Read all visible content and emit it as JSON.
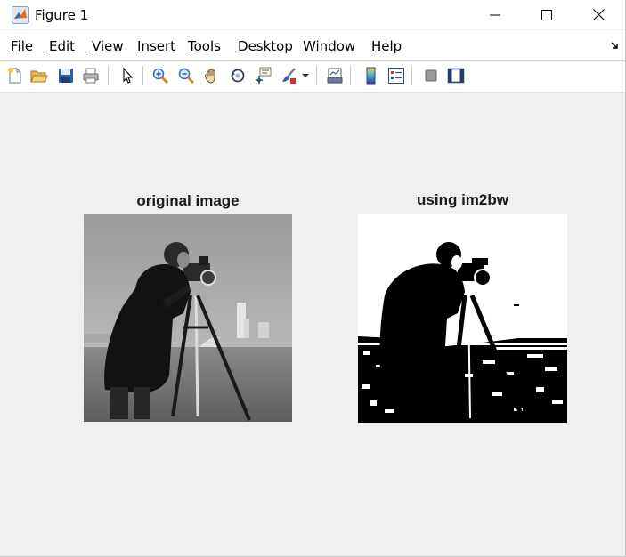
{
  "window": {
    "title": "Figure 1"
  },
  "menu": {
    "items": [
      {
        "mnemonic": "F",
        "rest": "ile"
      },
      {
        "mnemonic": "E",
        "rest": "dit"
      },
      {
        "mnemonic": "V",
        "rest": "iew"
      },
      {
        "mnemonic": "I",
        "rest": "nsert"
      },
      {
        "mnemonic": "T",
        "rest": "ools"
      },
      {
        "mnemonic": "D",
        "rest": "esktop"
      },
      {
        "mnemonic": "W",
        "rest": "indow"
      },
      {
        "mnemonic": "H",
        "rest": "elp"
      }
    ]
  },
  "toolbar": {
    "icons": [
      "new-figure-icon",
      "open-file-icon",
      "save-icon",
      "print-icon",
      "edit-plot-icon",
      "zoom-in-icon",
      "zoom-out-icon",
      "pan-icon",
      "rotate-3d-icon",
      "data-cursor-icon",
      "brush-icon",
      "brush-dropdown-icon",
      "link-plot-icon",
      "insert-colorbar-icon",
      "insert-legend-icon",
      "hide-plot-tools-icon",
      "show-plot-tools-icon"
    ]
  },
  "axes": [
    {
      "title": "original image"
    },
    {
      "title": "using im2bw"
    }
  ],
  "colors": {
    "window_bg": "#f0f0f0",
    "title_bar_bg": "#ffffff",
    "matlab_orange": "#e56a1a"
  }
}
